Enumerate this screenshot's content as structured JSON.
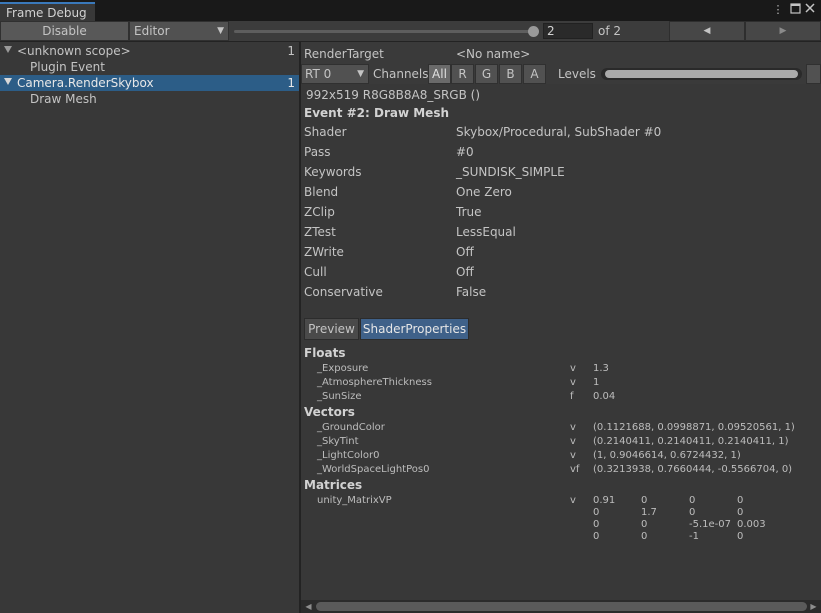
{
  "window": {
    "tab_title": "Frame Debug",
    "menu_icon": "kebab-menu-icon",
    "maximize_icon": "maximize-icon",
    "close_icon": "close-icon"
  },
  "toolbar": {
    "disable_label": "Disable",
    "target_dropdown": "Editor",
    "event_index": "2",
    "event_total": "of 2",
    "slider": {
      "value": 2,
      "min": 1,
      "max": 2
    },
    "prev_icon": "triangle-left-icon",
    "next_icon": "triangle-right-icon"
  },
  "tree": [
    {
      "label": "<unknown scope>",
      "count": "1",
      "expanded": true,
      "selected": false
    },
    {
      "label": "Plugin Event",
      "count": "",
      "expanded": null,
      "selected": false
    },
    {
      "label": "Camera.RenderSkybox",
      "count": "1",
      "expanded": true,
      "selected": true
    },
    {
      "label": "Draw Mesh",
      "count": "",
      "expanded": null,
      "selected": false
    }
  ],
  "details": {
    "render_target_label": "RenderTarget",
    "render_target_value": "<No name>",
    "rt_dropdown": "RT 0",
    "channels_label": "Channels",
    "channels": [
      "All",
      "R",
      "G",
      "B",
      "A"
    ],
    "active_channel": "All",
    "levels_label": "Levels",
    "format": "992x519 R8G8B8A8_SRGB ()",
    "event_title": "Event #2: Draw Mesh",
    "props": [
      {
        "label": "Shader",
        "value": "Skybox/Procedural, SubShader #0"
      },
      {
        "label": "Pass",
        "value": "#0"
      },
      {
        "label": "Keywords",
        "value": "_SUNDISK_SIMPLE"
      },
      {
        "label": "Blend",
        "value": "One Zero"
      },
      {
        "label": "ZClip",
        "value": "True"
      },
      {
        "label": "ZTest",
        "value": "LessEqual"
      },
      {
        "label": "ZWrite",
        "value": "Off"
      },
      {
        "label": "Cull",
        "value": "Off"
      },
      {
        "label": "Conservative",
        "value": "False"
      }
    ],
    "tabs": [
      "Preview",
      "ShaderProperties"
    ],
    "active_tab": "ShaderProperties"
  },
  "shader_properties": {
    "floats_title": "Floats",
    "floats": [
      {
        "name": "_Exposure",
        "stage": "v",
        "value": "1.3"
      },
      {
        "name": "_AtmosphereThickness",
        "stage": "v",
        "value": "1"
      },
      {
        "name": "_SunSize",
        "stage": "f",
        "value": "0.04"
      }
    ],
    "vectors_title": "Vectors",
    "vectors": [
      {
        "name": "_GroundColor",
        "stage": "v",
        "value": "(0.1121688, 0.0998871, 0.09520561, 1)"
      },
      {
        "name": "_SkyTint",
        "stage": "v",
        "value": "(0.2140411, 0.2140411, 0.2140411, 1)"
      },
      {
        "name": "_LightColor0",
        "stage": "v",
        "value": "(1, 0.9046614, 0.6724432, 1)"
      },
      {
        "name": "_WorldSpaceLightPos0",
        "stage": "vf",
        "value": "(0.3213938, 0.7660444, -0.5566704, 0)"
      }
    ],
    "matrices_title": "Matrices",
    "matrices": [
      {
        "name": "unity_MatrixVP",
        "stage": "v",
        "rows": [
          [
            "0.91",
            "0",
            "0",
            "0"
          ],
          [
            "0",
            "1.7",
            "0",
            "0"
          ],
          [
            "0",
            "0",
            "-5.1e-07",
            "0.003"
          ],
          [
            "0",
            "0",
            "-1",
            "0"
          ]
        ]
      }
    ]
  },
  "colors": {
    "background": "#383838",
    "selection": "#2c5d87",
    "active_tab": "#3f6189",
    "text": "#c4c4c4"
  }
}
